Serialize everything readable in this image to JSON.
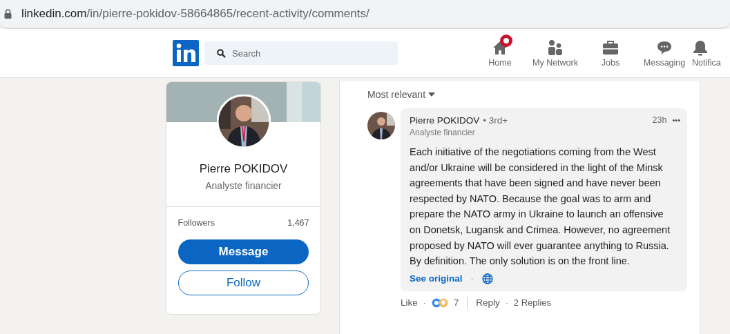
{
  "address_bar": {
    "domain": "linkedin.com",
    "path": "/in/pierre-pokidov-58664865/recent-activity/comments/"
  },
  "nav": {
    "search": {
      "placeholder": "Search"
    },
    "items": [
      {
        "label": "Home",
        "kind": "home",
        "badge": true
      },
      {
        "label": "My Network",
        "kind": "network",
        "badge": false
      },
      {
        "label": "Jobs",
        "kind": "jobs",
        "badge": false
      },
      {
        "label": "Messaging",
        "kind": "messaging",
        "badge": false
      },
      {
        "label": "Notifica",
        "kind": "bell",
        "badge": false
      }
    ]
  },
  "profile_card": {
    "name": "Pierre POKIDOV",
    "headline": "Analyste financier",
    "stats": [
      {
        "label": "Followers",
        "value": "1,467"
      }
    ],
    "buttons": [
      {
        "label": "Message",
        "kind": "primary"
      },
      {
        "label": "Follow",
        "kind": "secondary"
      }
    ]
  },
  "comments": {
    "sort": "Most relevant",
    "items": [
      {
        "author": "Pierre POKIDOV",
        "degree": "• 3rd+",
        "headline": "Analyste financier",
        "time": "23h",
        "more": "•••",
        "text": "Each initiative of the negotiations coming from the West and/or Ukraine will be considered in the light of the Minsk agreements that have been signed and have never been respected by NATO. Because the goal was to arm and prepare the NATO army in Ukraine to launch an offensive on Donetsk, Lugansk and Crimea. However, no agreement proposed by NATO will ever guarantee anything to Russia. By definition. The only solution is on the front line.",
        "see_original": "See original",
        "separator": "·",
        "actions": {
          "like": "Like",
          "reactions_count": "7",
          "reply": "Reply",
          "replies": "2 Replies"
        }
      }
    ]
  }
}
